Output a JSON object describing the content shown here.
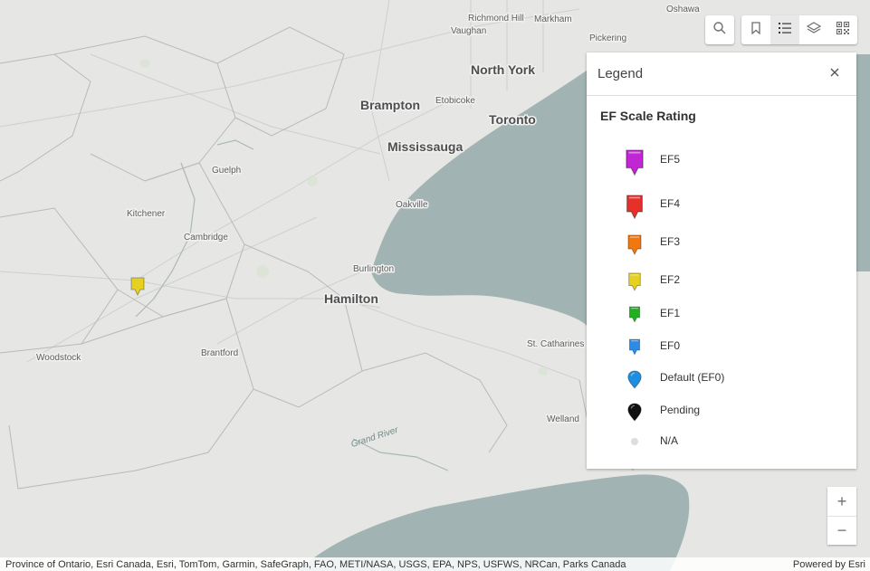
{
  "map": {
    "places": [
      {
        "name": "Oshawa",
        "size": "small"
      },
      {
        "name": "Richmond Hill",
        "size": "small"
      },
      {
        "name": "Markham",
        "size": "small"
      },
      {
        "name": "Vaughan",
        "size": "small"
      },
      {
        "name": "Pickering",
        "size": "small"
      },
      {
        "name": "North York",
        "size": "big"
      },
      {
        "name": "Brampton",
        "size": "big"
      },
      {
        "name": "Etobicoke",
        "size": "small"
      },
      {
        "name": "Toronto",
        "size": "big"
      },
      {
        "name": "Mississauga",
        "size": "big"
      },
      {
        "name": "Guelph",
        "size": "small"
      },
      {
        "name": "Kitchener",
        "size": "small"
      },
      {
        "name": "Oakville",
        "size": "small"
      },
      {
        "name": "Cambridge",
        "size": "small"
      },
      {
        "name": "Burlington",
        "size": "small"
      },
      {
        "name": "Hamilton",
        "size": "big"
      },
      {
        "name": "Woodstock",
        "size": "small"
      },
      {
        "name": "Brantford",
        "size": "small"
      },
      {
        "name": "St. Catharines",
        "size": "small"
      },
      {
        "name": "Welland",
        "size": "small"
      },
      {
        "name": "Grand River",
        "size": "lake"
      }
    ],
    "markers": [
      {
        "rating": "EF2",
        "color": "#e6d020"
      }
    ]
  },
  "toolbar": {
    "search_icon": "search-icon",
    "buttons": [
      {
        "name": "bookmarks",
        "icon": "bookmark-icon"
      },
      {
        "name": "legend",
        "icon": "legend-list-icon",
        "active": true
      },
      {
        "name": "layers",
        "icon": "layers-icon"
      },
      {
        "name": "qr-code",
        "icon": "qr-code-icon"
      }
    ]
  },
  "legend": {
    "title": "Legend",
    "layer_title": "EF Scale Rating",
    "items": [
      {
        "label": "EF5",
        "color": "#c026d3",
        "shape": "pin",
        "size": "xl"
      },
      {
        "label": "EF4",
        "color": "#e8302a",
        "shape": "pin",
        "size": "lg"
      },
      {
        "label": "EF3",
        "color": "#f0780e",
        "shape": "pin",
        "size": "md"
      },
      {
        "label": "EF2",
        "color": "#e6d020",
        "shape": "pin",
        "size": "sm"
      },
      {
        "label": "EF1",
        "color": "#22b022",
        "shape": "pin",
        "size": "xs"
      },
      {
        "label": "EF0",
        "color": "#2b8be8",
        "shape": "pin",
        "size": "xs"
      },
      {
        "label": "Default (EF0)",
        "color": "#1e8fe0",
        "shape": "drop",
        "size": "sm"
      },
      {
        "label": "Pending",
        "color": "#111111",
        "shape": "drop",
        "size": "sm"
      },
      {
        "label": "N/A",
        "color": "#dddddd",
        "shape": "dot",
        "size": "dot"
      }
    ]
  },
  "zoom": {
    "in_label": "+",
    "out_label": "−"
  },
  "attribution": {
    "sources": "Province of Ontario, Esri Canada, Esri, TomTom, Garmin, SafeGraph, FAO, METI/NASA, USGS, EPA, NPS, USFWS, NRCan, Parks Canada",
    "powered_by": "Powered by Esri"
  }
}
